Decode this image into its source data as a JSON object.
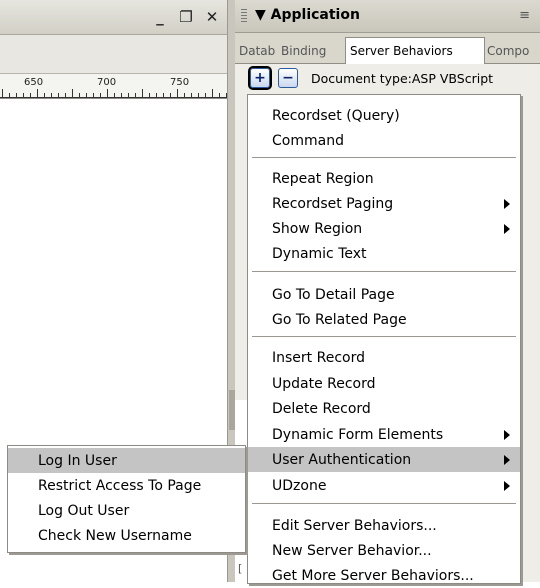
{
  "document_window": {
    "controls": {
      "minimize": "_",
      "restore": "❐",
      "close": "✕"
    },
    "ruler": {
      "labels": [
        "650",
        "700",
        "750"
      ]
    }
  },
  "panel": {
    "title": "▼ Application",
    "menu_icon": "options-menu-icon",
    "tabs": [
      {
        "label": "Datab"
      },
      {
        "label": "Binding"
      },
      {
        "label": "Server Behaviors"
      },
      {
        "label": "Compo"
      }
    ],
    "add_button": "+",
    "remove_button": "−",
    "document_type": "Document type:ASP VBScript",
    "tree_bracket": "["
  },
  "server_behaviors_menu": {
    "items": [
      {
        "label": "Recordset (Query)"
      },
      {
        "label": "Command"
      },
      {
        "label": "Repeat Region"
      },
      {
        "label": "Recordset Paging",
        "submenu": true
      },
      {
        "label": "Show Region",
        "submenu": true
      },
      {
        "label": "Dynamic Text"
      },
      {
        "label": "Go To Detail Page"
      },
      {
        "label": "Go To Related Page"
      },
      {
        "label": "Insert Record"
      },
      {
        "label": "Update Record"
      },
      {
        "label": "Delete Record"
      },
      {
        "label": "Dynamic Form Elements",
        "submenu": true
      },
      {
        "label": "User Authentication",
        "submenu": true,
        "highlighted": true
      },
      {
        "label": "UDzone",
        "submenu": true
      },
      {
        "label": "Edit Server Behaviors..."
      },
      {
        "label": "New Server Behavior..."
      },
      {
        "label": "Get More Server Behaviors..."
      }
    ]
  },
  "user_authentication_submenu": {
    "items": [
      {
        "label": "Log In User",
        "highlighted": true
      },
      {
        "label": "Restrict Access To Page"
      },
      {
        "label": "Log Out User"
      },
      {
        "label": "Check New Username"
      }
    ]
  },
  "colors": {
    "menu_highlight": "#c4c4c4",
    "panel_background": "#eeede7",
    "button_border": "#2c5aa0"
  }
}
